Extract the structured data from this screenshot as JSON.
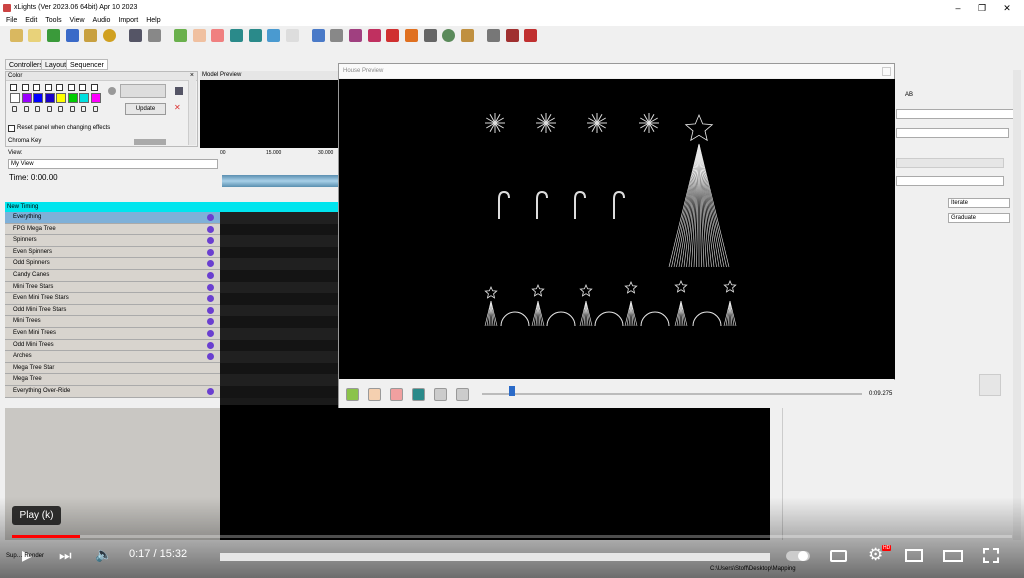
{
  "window": {
    "title": "xLights (Ver 2023.06 64bit) Apr 10 2023",
    "buttons": [
      "–",
      "❐",
      "✕"
    ]
  },
  "menu": [
    "File",
    "Edit",
    "Tools",
    "View",
    "Audio",
    "Import",
    "Help"
  ],
  "tabs": [
    "Controllers",
    "Layout",
    "Sequencer"
  ],
  "color_panel": {
    "title": "Color",
    "update": "Update",
    "reset_label": "Reset panel when changing effects",
    "chroma_label": "Chroma Key",
    "palette": [
      "#ffffff",
      "#9a00ff",
      "#0000ff",
      "#1a00c8",
      "#ffff00",
      "#00cc00",
      "#00e0e0",
      "#ff00ff"
    ]
  },
  "model_preview_label": "Model Preview",
  "view": {
    "label": "View:",
    "value": "My View",
    "time": "Time: 0:00.00"
  },
  "timeline": {
    "ticks": [
      "00",
      "15.000",
      "30.000"
    ]
  },
  "timing": "New Timing",
  "rows": [
    {
      "name": "Everything",
      "icon": true,
      "selected": true
    },
    {
      "name": "FPG Mega Tree",
      "icon": true
    },
    {
      "name": "Spinners",
      "icon": true
    },
    {
      "name": "Even Spinners",
      "icon": true
    },
    {
      "name": "Odd Spinners",
      "icon": true
    },
    {
      "name": "Candy Canes",
      "icon": true
    },
    {
      "name": "Mini Tree Stars",
      "icon": true
    },
    {
      "name": "Even Mini Tree Stars",
      "icon": true
    },
    {
      "name": "Odd Mini Tree Stars",
      "icon": true
    },
    {
      "name": "Mini Trees",
      "icon": true
    },
    {
      "name": "Even Mini Trees",
      "icon": true
    },
    {
      "name": "Odd Mini Trees",
      "icon": true
    },
    {
      "name": "Arches",
      "icon": true
    },
    {
      "name": "Mega Tree Star",
      "icon": false
    },
    {
      "name": "Mega Tree",
      "icon": false
    },
    {
      "name": "Everything Over-Ride",
      "icon": true
    }
  ],
  "house_preview": {
    "title": "House Preview",
    "time": "0:09.275",
    "position": 0.07
  },
  "right_panel": {
    "iterate": "Iterate",
    "graduate": "Graduate",
    "label_ab": "AB"
  },
  "youtube": {
    "tooltip": "Play (k)",
    "time": "0:17 / 15:32",
    "progress": 0.018,
    "hd_badge": "HD"
  },
  "status": {
    "path": "C:\\Users\\Stoff\\Desktop\\Mapping",
    "render": "Sup…   Render"
  }
}
